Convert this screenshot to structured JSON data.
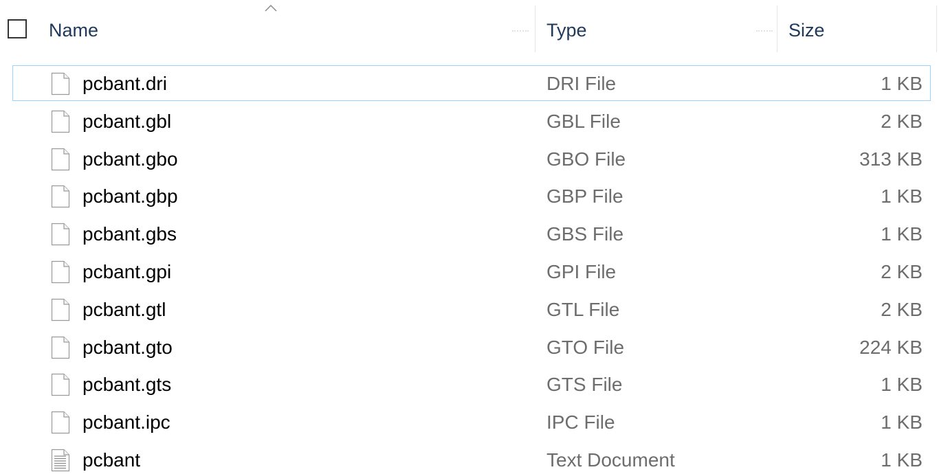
{
  "header": {
    "columns": {
      "name": "Name",
      "type": "Type",
      "size": "Size"
    },
    "sort_column": "name",
    "sort_direction": "ascending"
  },
  "files": [
    {
      "name": "pcbant.dri",
      "type": "DRI File",
      "size": "1 KB",
      "icon": "generic-file-icon",
      "focused": true
    },
    {
      "name": "pcbant.gbl",
      "type": "GBL File",
      "size": "2 KB",
      "icon": "generic-file-icon"
    },
    {
      "name": "pcbant.gbo",
      "type": "GBO File",
      "size": "313 KB",
      "icon": "generic-file-icon"
    },
    {
      "name": "pcbant.gbp",
      "type": "GBP File",
      "size": "1 KB",
      "icon": "generic-file-icon"
    },
    {
      "name": "pcbant.gbs",
      "type": "GBS File",
      "size": "1 KB",
      "icon": "generic-file-icon"
    },
    {
      "name": "pcbant.gpi",
      "type": "GPI File",
      "size": "2 KB",
      "icon": "generic-file-icon"
    },
    {
      "name": "pcbant.gtl",
      "type": "GTL File",
      "size": "2 KB",
      "icon": "generic-file-icon"
    },
    {
      "name": "pcbant.gto",
      "type": "GTO File",
      "size": "224 KB",
      "icon": "generic-file-icon"
    },
    {
      "name": "pcbant.gts",
      "type": "GTS File",
      "size": "1 KB",
      "icon": "generic-file-icon"
    },
    {
      "name": "pcbant.ipc",
      "type": "IPC File",
      "size": "1 KB",
      "icon": "generic-file-icon"
    },
    {
      "name": "pcbant",
      "type": "Text Document",
      "size": "1 KB",
      "icon": "text-document-icon"
    }
  ],
  "colors": {
    "header_text": "#1e395b",
    "focus_border": "#99d1ff",
    "secondary_text": "#6d6d6d"
  }
}
